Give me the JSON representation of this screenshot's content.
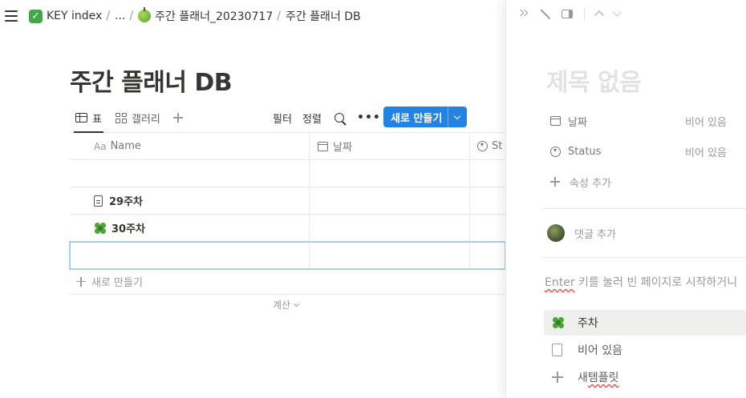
{
  "breadcrumb": {
    "items": [
      {
        "label": "KEY index",
        "icon": "check-mark-icon"
      },
      {
        "label": "..."
      },
      {
        "label": "주간 플래너_20230717",
        "icon": "green-apple-icon"
      },
      {
        "label": "주간 플래너 DB"
      }
    ],
    "separator": "/"
  },
  "page": {
    "title": "주간 플래너 DB"
  },
  "views": {
    "tabs": [
      {
        "label": "표",
        "icon": "table-icon",
        "active": true
      },
      {
        "label": "갤러리",
        "icon": "gallery-icon",
        "active": false
      }
    ]
  },
  "toolbar": {
    "filter_label": "필터",
    "sort_label": "정렬",
    "new_label": "새로 만들기"
  },
  "table": {
    "columns": [
      {
        "label": "Name",
        "prefix": "Aa",
        "icon": "text-icon"
      },
      {
        "label": "날짜",
        "icon": "calendar-icon"
      },
      {
        "label": "St",
        "icon": "status-icon"
      }
    ],
    "rows": [
      {
        "name": ""
      },
      {
        "name": "29주차",
        "icon": "document-icon"
      },
      {
        "name": "30주차",
        "icon": "four-leaf-clover-icon"
      },
      {
        "name": "",
        "selected": true
      }
    ],
    "add_row_label": "새로 만들기",
    "calc_label": "계산"
  },
  "peek": {
    "title": "제목 없음",
    "properties": [
      {
        "name": "날짜",
        "icon": "calendar-icon",
        "value": "비어 있음"
      },
      {
        "name": "Status",
        "icon": "status-icon",
        "value": "비어 있음"
      }
    ],
    "add_property_label": "속성 추가",
    "comment_placeholder": "댓글 추가",
    "hint_enter": "Enter",
    "hint_rest": " 키를 눌러 빈 페이지로 시작하거니",
    "templates": [
      {
        "label": "주차",
        "icon": "four-leaf-clover-icon",
        "highlighted": true
      },
      {
        "label": "비어 있음",
        "icon": "document-icon"
      },
      {
        "label_prefix": "새 ",
        "label_main": "템플릿",
        "icon": "plus-icon"
      }
    ]
  },
  "colors": {
    "accent": "#2383e2",
    "text": "#37352f",
    "muted": "#9b9a97",
    "border": "#e9e9e7",
    "selection": "#a8cdf1"
  }
}
